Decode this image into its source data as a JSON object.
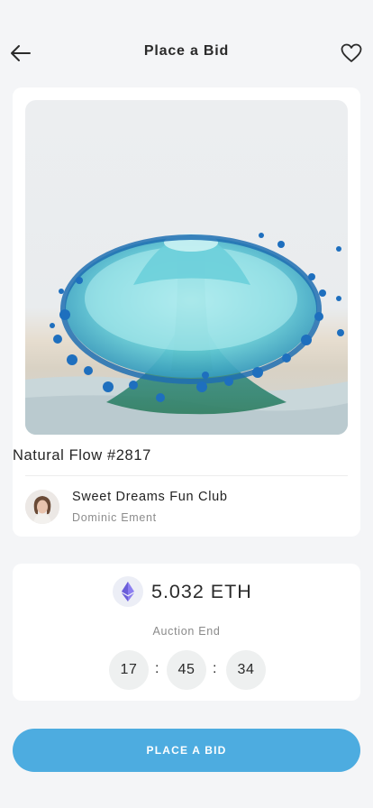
{
  "header": {
    "title": "Place a Bid",
    "back_icon": "arrow-left-icon",
    "favorite_icon": "heart-icon"
  },
  "nft": {
    "name": "Natural Flow #2817",
    "creator_name": "Sweet Dreams Fun Club",
    "owner_name": "Dominic Ement"
  },
  "auction": {
    "currency_icon": "ethereum-icon",
    "price": "5.032 ETH",
    "label": "Auction End",
    "timer": {
      "hours": "17",
      "minutes": "45",
      "seconds": "34",
      "separator": ":"
    }
  },
  "action": {
    "bid_label": "PLACE A BID"
  },
  "colors": {
    "accent": "#4dace0",
    "background": "#f4f5f7",
    "ethereum": "#7b6fe0"
  }
}
